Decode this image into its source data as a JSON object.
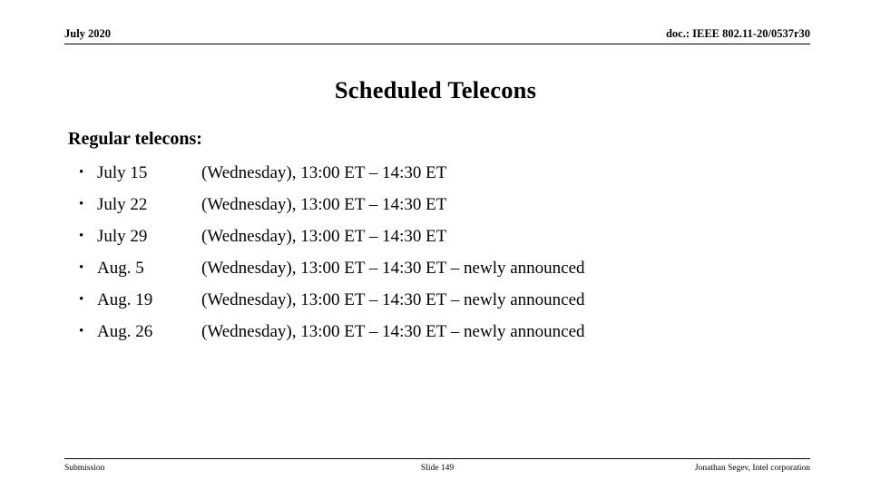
{
  "header": {
    "left_text": "July 2020",
    "right_text": "doc.: IEEE 802.11-20/0537r30"
  },
  "title": "Scheduled Telecons",
  "body": {
    "heading": "Regular telecons:",
    "bullet_glyph": "•",
    "rows": [
      {
        "date": "July 15",
        "detail": "(Wednesday), 13:00 ET – 14:30 ET"
      },
      {
        "date": "July 22",
        "detail": "(Wednesday), 13:00 ET – 14:30 ET"
      },
      {
        "date": "July 29",
        "detail": "(Wednesday), 13:00 ET – 14:30 ET"
      },
      {
        "date": "Aug. 5",
        "detail": "(Wednesday), 13:00 ET – 14:30 ET – newly announced"
      },
      {
        "date": "Aug. 19",
        "detail": "(Wednesday), 13:00 ET – 14:30 ET – newly announced"
      },
      {
        "date": "Aug. 26",
        "detail": "(Wednesday), 13:00 ET – 14:30 ET – newly announced"
      }
    ]
  },
  "footer": {
    "left_text": "Submission",
    "center_text": "Slide 149",
    "right_text": "Jonathan Segev, Intel corporation"
  },
  "colors": {
    "background": "#ffffff",
    "text": "#000000",
    "rule": "#000000"
  }
}
